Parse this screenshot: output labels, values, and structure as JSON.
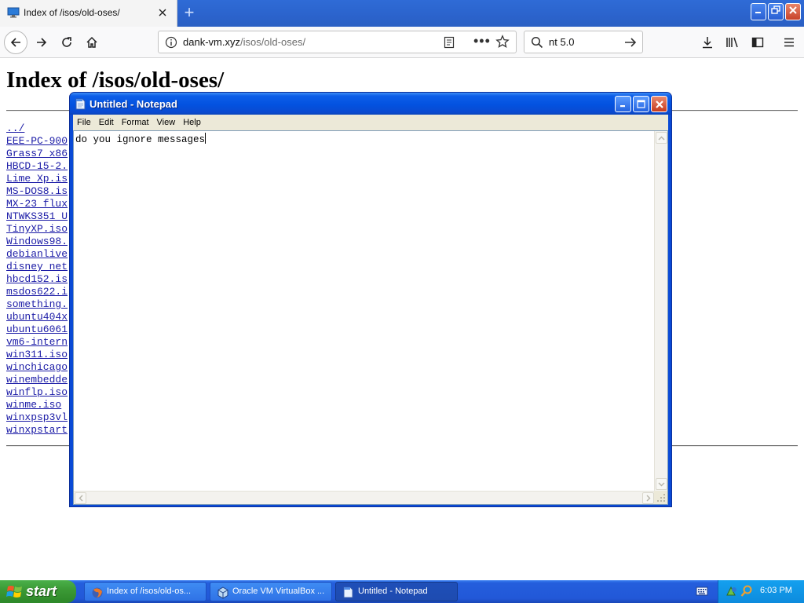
{
  "browser": {
    "tab": {
      "title": "Index of /isos/old-oses/"
    },
    "url": {
      "host": "dank-vm.xyz",
      "path": "/isos/old-oses/"
    },
    "search": {
      "value": "nt 5.0"
    }
  },
  "page": {
    "heading": "Index of /isos/old-oses/",
    "files": [
      "../",
      "EEE-PC-900",
      "Grass7 x86",
      "HBCD-15-2.",
      "Lime Xp.is",
      "MS-DOS8.is",
      "MX-23 flux",
      "NTWKS351 U",
      "TinyXP.iso",
      "Windows98.",
      "debianlive",
      "disney net",
      "hbcd152.is",
      "msdos622.i",
      "something.",
      "ubuntu404x",
      "ubuntu6061",
      "vm6-intern",
      "win311.iso",
      "winchicago",
      "winembedde",
      "winflp.iso",
      "winme.iso",
      "winxpsp3vl",
      "winxpstart"
    ]
  },
  "notepad": {
    "title": "Untitled - Notepad",
    "menu": [
      "File",
      "Edit",
      "Format",
      "View",
      "Help"
    ],
    "text": "do you ignore messages"
  },
  "taskbar": {
    "start_label": "start",
    "tasks": [
      {
        "label": "Index of /isos/old-os...",
        "icon": "firefox-icon"
      },
      {
        "label": "Oracle VM VirtualBox ...",
        "icon": "virtualbox-icon"
      },
      {
        "label": "Untitled - Notepad",
        "icon": "notepad-icon"
      }
    ],
    "clock": "6:03 PM"
  },
  "colors": {
    "link": "#1a1aa6",
    "xp_blue": "#0a4ad6",
    "start_green": "#3c9a36"
  }
}
